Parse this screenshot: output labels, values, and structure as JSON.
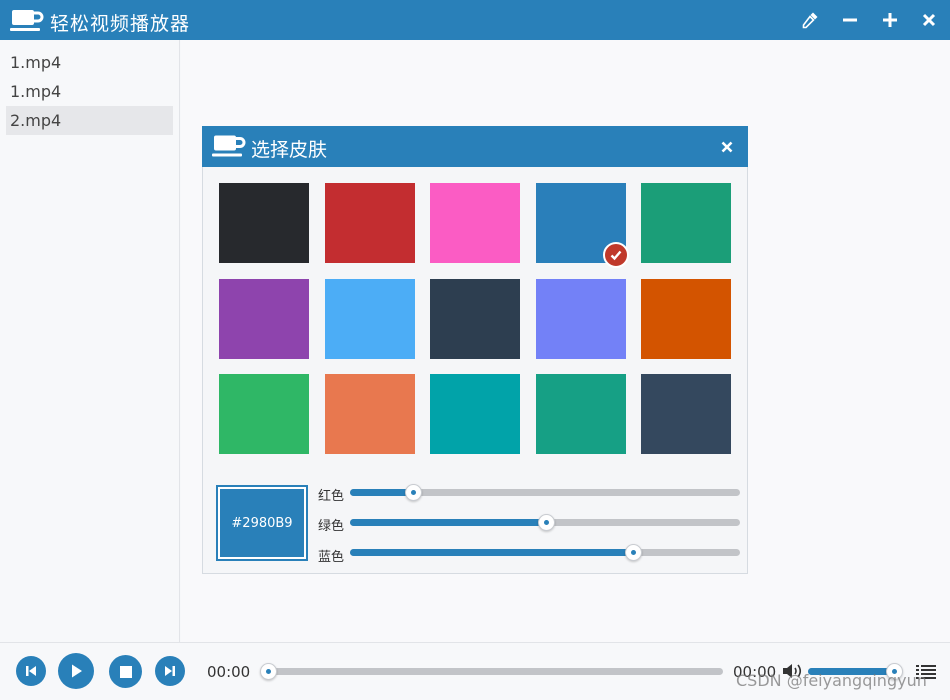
{
  "window": {
    "title": "轻松视频播放器",
    "buttons": [
      {
        "name": "eyedropper-button",
        "icon": "eyedropper-icon"
      },
      {
        "name": "minimize-button",
        "icon": "minus-icon"
      },
      {
        "name": "maximize-button",
        "icon": "plus-icon"
      },
      {
        "name": "close-button",
        "icon": "close-icon"
      }
    ]
  },
  "playlist": {
    "items": [
      {
        "label": "1.mp4",
        "active": false
      },
      {
        "label": "1.mp4",
        "active": false
      },
      {
        "label": "2.mp4",
        "active": true
      }
    ]
  },
  "skin_dialog": {
    "title": "选择皮肤",
    "selected_index": 3,
    "swatches": [
      "#27292d",
      "#c32d30",
      "#fb5cc4",
      "#2a7fba",
      "#1b9e78",
      "#8e44ad",
      "#4cadf6",
      "#2d3e50",
      "#7381f7",
      "#d35400",
      "#2fb766",
      "#e8784f",
      "#01a3a9",
      "#16a085",
      "#34485e"
    ],
    "preview": {
      "hex": "#2980B9"
    },
    "sliders": [
      {
        "label": "红色",
        "value": 41,
        "max": 255
      },
      {
        "label": "绿色",
        "value": 128,
        "max": 255
      },
      {
        "label": "蓝色",
        "value": 185,
        "max": 255
      }
    ]
  },
  "player": {
    "current_time": "00:00",
    "total_time": "00:00",
    "progress": 0,
    "volume": 1.0,
    "controls": [
      "previous-icon",
      "play-icon",
      "stop-icon",
      "next-icon"
    ]
  },
  "watermark": "CSDN @feiyangqingyun",
  "colors": {
    "accent": "#2980b9",
    "check_badge": "#c0392b"
  }
}
